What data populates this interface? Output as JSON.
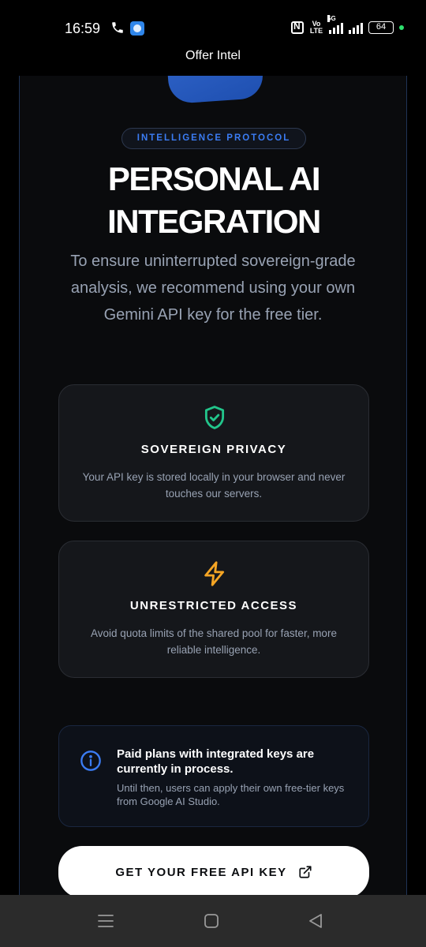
{
  "status_bar": {
    "time": "16:59",
    "battery": "64",
    "network_label": "5G",
    "volte_line1": "Vo",
    "volte_line2": "LTE"
  },
  "app": {
    "title": "Offer Intel"
  },
  "hero": {
    "badge": "INTELLIGENCE PROTOCOL",
    "headline_line1": "PERSONAL AI",
    "headline_line2": "INTEGRATION",
    "intro": "To ensure uninterrupted sovereign-grade analysis, we recommend using your own Gemini API key for the free tier."
  },
  "features": [
    {
      "icon": "shield-check-icon",
      "title": "SOVEREIGN PRIVACY",
      "description": "Your API key is stored locally in your browser and never touches our servers."
    },
    {
      "icon": "lightning-bolt-icon",
      "title": "UNRESTRICTED ACCESS",
      "description": "Avoid quota limits of the shared pool for faster, more reliable intelligence."
    }
  ],
  "notice": {
    "icon": "info-icon",
    "title": "Paid plans with integrated keys are currently in process.",
    "description": "Until then, users can apply their own free-tier keys from Google AI Studio."
  },
  "cta": {
    "label": "GET YOUR FREE API KEY",
    "icon": "external-link-icon"
  },
  "colors": {
    "accent_blue": "#3b7cf3",
    "privacy_green": "#22c58b",
    "bolt_orange": "#f5a524",
    "background": "#0a0b0d",
    "muted_text": "#98a2b3"
  }
}
